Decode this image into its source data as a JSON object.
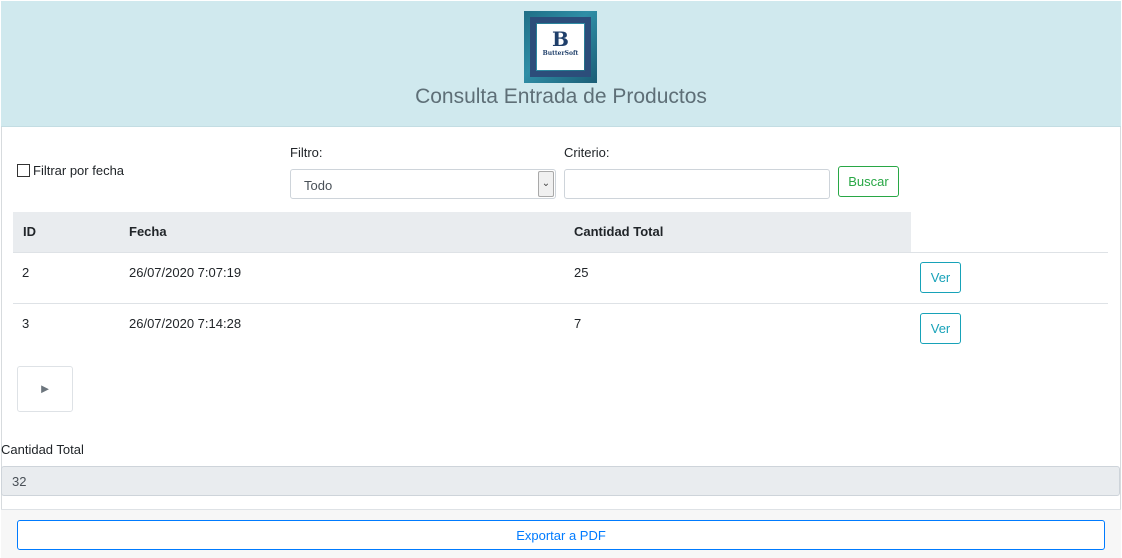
{
  "header": {
    "logo": {
      "mark": "B",
      "brand": "ButterSoft",
      "colors": {
        "frame": "#2c4d7a",
        "background": "#1f6e86"
      }
    },
    "title": "Consulta Entrada de Productos"
  },
  "filters": {
    "date_checkbox_label": "Filtrar por fecha",
    "date_checkbox_checked": false,
    "filter_label": "Filtro:",
    "filter_selected": "Todo",
    "criteria_label": "Criterio:",
    "criteria_value": "",
    "search_button": "Buscar"
  },
  "table": {
    "columns": [
      "ID",
      "Fecha",
      "Cantidad Total"
    ],
    "rows": [
      {
        "id": "2",
        "fecha": "26/07/2020 7:07:19",
        "cantidad": "25",
        "action": "Ver"
      },
      {
        "id": "3",
        "fecha": "26/07/2020 7:14:28",
        "cantidad": "7",
        "action": "Ver"
      }
    ]
  },
  "pager": {
    "next_icon": "play-icon",
    "glyph": "►"
  },
  "summary": {
    "total_label": "Cantidad Total",
    "total_value": "32"
  },
  "footer": {
    "export_button": "Exportar a PDF"
  },
  "colors": {
    "header_bg": "#d0e9ee",
    "success": "#28a745",
    "info": "#17a2b8",
    "primary": "#007bff"
  }
}
